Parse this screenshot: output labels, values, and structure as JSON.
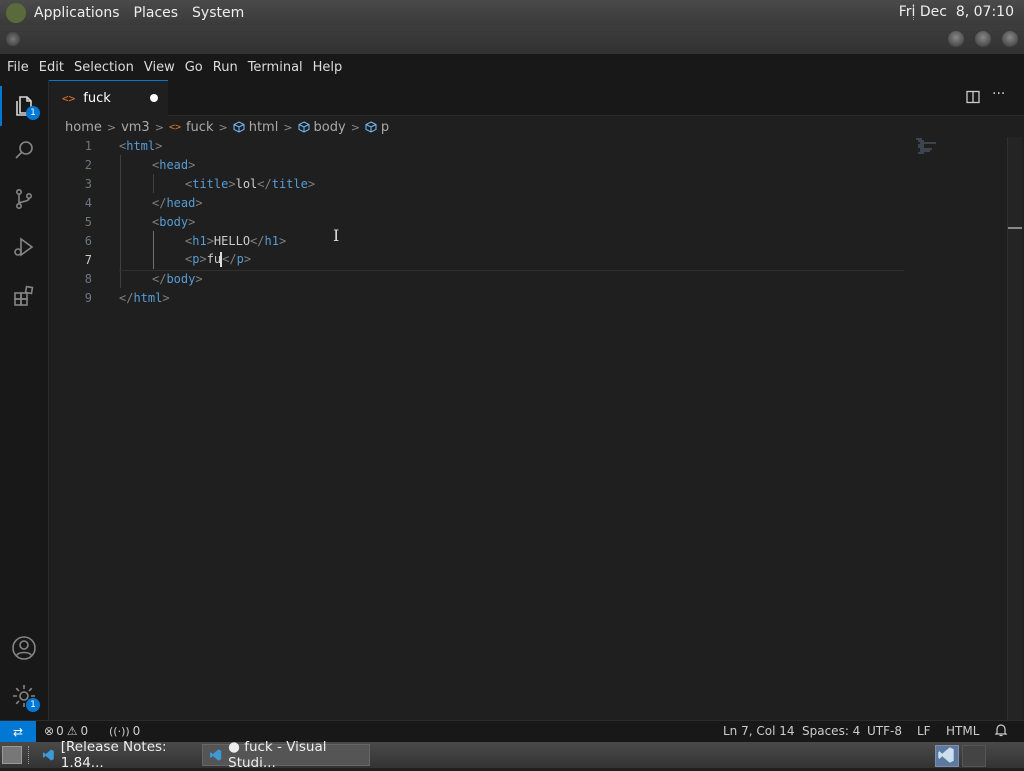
{
  "topbar": {
    "menus": [
      "Applications",
      "Places",
      "System"
    ],
    "clock": "Fri Dec  8, 07:10"
  },
  "menubar": [
    "File",
    "Edit",
    "Selection",
    "View",
    "Go",
    "Run",
    "Terminal",
    "Help"
  ],
  "activity": {
    "explorer_badge": "1",
    "settings_badge": "1"
  },
  "tab": {
    "icon": "<>",
    "label": "fuck"
  },
  "breadcrumb": {
    "items": [
      "home",
      "vm3",
      "fuck",
      "html",
      "body",
      "p"
    ]
  },
  "editor": {
    "lines": [
      {
        "n": "1",
        "indent": 0,
        "parts": [
          [
            "tag",
            "<"
          ],
          [
            "tname",
            "html"
          ],
          [
            "tag",
            ">"
          ]
        ]
      },
      {
        "n": "2",
        "indent": 1,
        "parts": [
          [
            "tag",
            "<"
          ],
          [
            "tname",
            "head"
          ],
          [
            "tag",
            ">"
          ]
        ]
      },
      {
        "n": "3",
        "indent": 2,
        "parts": [
          [
            "tag",
            "<"
          ],
          [
            "tname",
            "title"
          ],
          [
            "tag",
            ">"
          ],
          [
            "txt",
            "lol"
          ],
          [
            "tag",
            "</"
          ],
          [
            "tname",
            "title"
          ],
          [
            "tag",
            ">"
          ]
        ]
      },
      {
        "n": "4",
        "indent": 1,
        "parts": [
          [
            "tag",
            "</"
          ],
          [
            "tname",
            "head"
          ],
          [
            "tag",
            ">"
          ]
        ]
      },
      {
        "n": "5",
        "indent": 1,
        "parts": [
          [
            "tag",
            "<"
          ],
          [
            "tname",
            "body"
          ],
          [
            "tag",
            ">"
          ]
        ]
      },
      {
        "n": "6",
        "indent": 2,
        "parts": [
          [
            "tag",
            "<"
          ],
          [
            "tname",
            "h1"
          ],
          [
            "tag",
            ">"
          ],
          [
            "txt",
            "HELLO"
          ],
          [
            "tag",
            "</"
          ],
          [
            "tname",
            "h1"
          ],
          [
            "tag",
            ">"
          ]
        ]
      },
      {
        "n": "7",
        "indent": 2,
        "parts": [
          [
            "tag",
            "<"
          ],
          [
            "tname",
            "p"
          ],
          [
            "tag",
            ">"
          ],
          [
            "txt",
            "fu"
          ],
          [
            "cursor",
            ""
          ],
          [
            "tag",
            "</"
          ],
          [
            "tname",
            "p"
          ],
          [
            "tag",
            ">"
          ]
        ]
      },
      {
        "n": "8",
        "indent": 1,
        "parts": [
          [
            "tag",
            "</"
          ],
          [
            "tname",
            "body"
          ],
          [
            "tag",
            ">"
          ]
        ]
      },
      {
        "n": "9",
        "indent": 0,
        "parts": [
          [
            "tag",
            "</"
          ],
          [
            "tname",
            "html"
          ],
          [
            "tag",
            ">"
          ]
        ]
      }
    ],
    "current_line": "7"
  },
  "statusbar": {
    "errors": "0",
    "warnings": "0",
    "ports": "0",
    "position": "Ln 7, Col 14",
    "spaces": "Spaces: 4",
    "encoding": "UTF-8",
    "eol": "LF",
    "language": "HTML"
  },
  "taskbar": {
    "items": [
      "[Release Notes: 1.84...",
      "● fuck - Visual Studi..."
    ]
  },
  "colors": {
    "accent": "#0078d4",
    "tag_name": "#569cd6",
    "bracket": "#808080"
  }
}
